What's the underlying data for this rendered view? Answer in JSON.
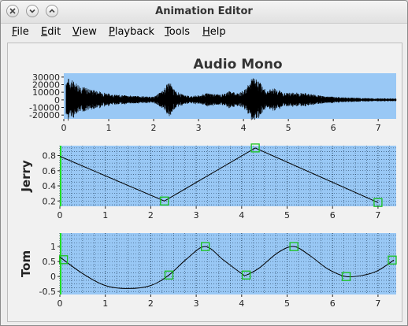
{
  "window": {
    "title": "Animation Editor"
  },
  "menu": [
    {
      "label": "File",
      "u": "F",
      "rest": "ile"
    },
    {
      "label": "Edit",
      "u": "E",
      "rest": "dit"
    },
    {
      "label": "View",
      "u": "V",
      "rest": "iew"
    },
    {
      "label": "Playback",
      "u": "P",
      "rest": "layback"
    },
    {
      "label": "Tools",
      "u": "T",
      "rest": "ools"
    },
    {
      "label": "Help",
      "u": "H",
      "rest": "elp"
    }
  ],
  "colors": {
    "plot_bg": "#99c8f5",
    "marker": "#18c21e",
    "accent": "#22dd22"
  },
  "chart_data": [
    {
      "type": "line",
      "title": "Audio Mono",
      "ylabel": "",
      "xlim": [
        0,
        7.4
      ],
      "ylim": [
        -25000,
        35000
      ],
      "xticks": [
        0,
        1,
        2,
        3,
        4,
        5,
        6,
        7
      ],
      "yticks": [
        30000,
        20000,
        10000,
        0,
        -10000,
        -20000
      ],
      "ytick_labels": [
        "30000",
        "20000",
        "10000",
        "0",
        "-10000",
        "-20000"
      ],
      "series": [
        {
          "name": "",
          "description": "audio waveform",
          "envelope": [
            [
              0.05,
              30000
            ],
            [
              0.2,
              26000
            ],
            [
              0.4,
              18000
            ],
            [
              0.6,
              14000
            ],
            [
              0.9,
              10000
            ],
            [
              1.1,
              7000
            ],
            [
              1.4,
              6000
            ],
            [
              1.7,
              5000
            ],
            [
              2.0,
              4000
            ],
            [
              2.2,
              12000
            ],
            [
              2.35,
              25000
            ],
            [
              2.45,
              14000
            ],
            [
              2.6,
              8000
            ],
            [
              2.8,
              5000
            ],
            [
              3.0,
              6000
            ],
            [
              3.2,
              9000
            ],
            [
              3.5,
              7000
            ],
            [
              3.7,
              12000
            ],
            [
              3.9,
              9000
            ],
            [
              4.05,
              14000
            ],
            [
              4.2,
              30000
            ],
            [
              4.35,
              25000
            ],
            [
              4.5,
              12000
            ],
            [
              4.7,
              16000
            ],
            [
              4.9,
              9000
            ],
            [
              5.2,
              10000
            ],
            [
              5.5,
              8000
            ],
            [
              5.8,
              5000
            ],
            [
              6.2,
              3500
            ],
            [
              6.6,
              2500
            ],
            [
              7.0,
              2000
            ],
            [
              7.4,
              2000
            ]
          ]
        }
      ]
    },
    {
      "type": "line",
      "title": "",
      "ylabel": "Jerry",
      "xlim": [
        0,
        7.4
      ],
      "ylim": [
        0.13,
        0.93
      ],
      "xticks": [
        0,
        1,
        2,
        3,
        4,
        5,
        6,
        7
      ],
      "yticks": [
        0.8,
        0.6,
        0.4,
        0.2
      ],
      "ytick_labels": [
        "0.8",
        "0.6",
        "0.4",
        "0.2"
      ],
      "series": [
        {
          "name": "",
          "x": [
            0,
            2.3,
            4.3,
            7.0
          ],
          "y": [
            0.79,
            0.2,
            0.9,
            0.18
          ]
        }
      ],
      "keyframes": [
        2.3,
        4.3,
        7.0
      ]
    },
    {
      "type": "line",
      "title": "",
      "ylabel": "Tom",
      "xlim": [
        0,
        7.4
      ],
      "ylim": [
        -0.6,
        1.45
      ],
      "xticks": [
        0,
        1,
        2,
        3,
        4,
        5,
        6,
        7
      ],
      "yticks": [
        1,
        0.5,
        0,
        -0.5
      ],
      "ytick_labels": [
        "1",
        "0.5",
        "0",
        "-0.5"
      ],
      "series": [
        {
          "name": "",
          "x": [
            0,
            0.5,
            1.0,
            1.5,
            2.0,
            2.4,
            2.8,
            3.2,
            3.6,
            4.0,
            4.1,
            4.4,
            4.8,
            5.15,
            5.5,
            5.9,
            6.3,
            6.7,
            7.0,
            7.35
          ],
          "y": [
            0.65,
            0.1,
            -0.3,
            -0.4,
            -0.3,
            0.05,
            0.6,
            1.0,
            0.55,
            0.1,
            0.05,
            0.3,
            0.8,
            1.0,
            0.7,
            0.25,
            0.0,
            0.05,
            0.2,
            0.55
          ]
        }
      ],
      "keyframes": [
        0.08,
        2.4,
        3.2,
        4.1,
        5.15,
        6.3,
        7.35
      ]
    }
  ]
}
